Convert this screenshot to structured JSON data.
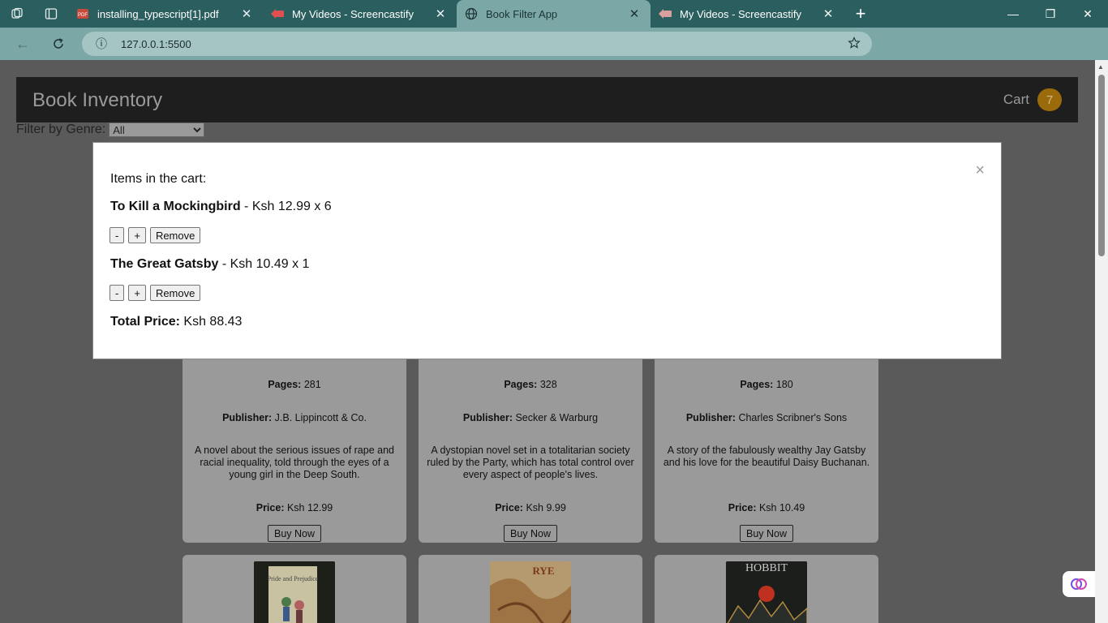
{
  "browser": {
    "tabs": [
      {
        "title": "installing_typescript[1].pdf",
        "icon": "pdf-icon"
      },
      {
        "title": "My Videos - Screencastify",
        "icon": "screencastify-icon"
      },
      {
        "title": "Book Filter App",
        "icon": "globe-icon",
        "active": true
      },
      {
        "title": "My Videos - Screencastify",
        "icon": "screencastify-icon"
      }
    ],
    "url": "127.0.0.1:5500"
  },
  "app": {
    "brand": "Book Inventory",
    "cart_label": "Cart",
    "cart_count": "7",
    "filter_label": "Filter by Genre:",
    "filter_selected": "All"
  },
  "cards": [
    {
      "pages_label": "Pages:",
      "pages": "281",
      "publisher_label": "Publisher:",
      "publisher": "J.B. Lippincott & Co.",
      "description": "A novel about the serious issues of rape and racial inequality, told through the eyes of a young girl in the Deep South.",
      "price_label": "Price:",
      "price": "Ksh 12.99",
      "buy_label": "Buy Now"
    },
    {
      "pages_label": "Pages:",
      "pages": "328",
      "publisher_label": "Publisher:",
      "publisher": "Secker & Warburg",
      "description": "A dystopian novel set in a totalitarian society ruled by the Party, which has total control over every aspect of people's lives.",
      "price_label": "Price:",
      "price": "Ksh 9.99",
      "buy_label": "Buy Now"
    },
    {
      "pages_label": "Pages:",
      "pages": "180",
      "publisher_label": "Publisher:",
      "publisher": "Charles Scribner's Sons",
      "description": "A story of the fabulously wealthy Jay Gatsby and his love for the beautiful Daisy Buchanan.",
      "price_label": "Price:",
      "price": "Ksh 10.49",
      "buy_label": "Buy Now"
    }
  ],
  "covers": [
    {
      "text": "Pride and Prejudice",
      "icon": "book-cover-pride-and-prejudice"
    },
    {
      "text": "RYE",
      "icon": "book-cover-catcher-in-the-rye"
    },
    {
      "text": "HOBBIT",
      "icon": "book-cover-hobbit"
    }
  ],
  "modal": {
    "heading": "Items in the cart:",
    "close_symbol": "×",
    "items": [
      {
        "title": "To Kill a Mockingbird",
        "detail": " - Ksh 12.99 x 6"
      },
      {
        "title": "The Great Gatsby",
        "detail": " - Ksh 10.49 x 1"
      }
    ],
    "minus_label": "-",
    "plus_label": "+",
    "remove_label": "Remove",
    "total_label": "Total Price:",
    "total_value": " Ksh 88.43"
  },
  "colors": {
    "tabbar": "#2b5e5e",
    "addressbar": "#7ba7a7",
    "overlay_page": "#5a5a5a",
    "cart_badge": "#9a6a0b"
  }
}
